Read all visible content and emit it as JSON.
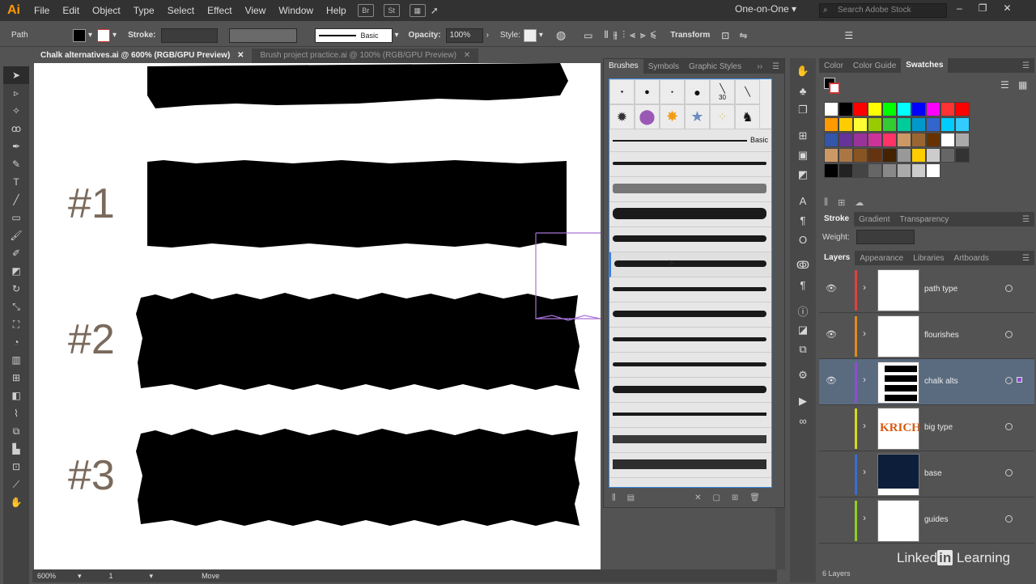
{
  "app": {
    "logo": "Ai"
  },
  "menu": [
    "File",
    "Edit",
    "Object",
    "Type",
    "Select",
    "Effect",
    "View",
    "Window",
    "Help"
  ],
  "menu_icons": [
    "Br",
    "St"
  ],
  "workspace": "One-on-One",
  "search_placeholder": "Search Adobe Stock",
  "control": {
    "object_type": "Path",
    "stroke_label": "Stroke:",
    "brush_name": "Basic",
    "opacity_label": "Opacity:",
    "opacity_value": "100%",
    "style_label": "Style:",
    "transform_label": "Transform"
  },
  "doc_tabs": [
    {
      "label": "Chalk alternatives.ai @ 600% (RGB/GPU Preview)",
      "active": true
    },
    {
      "label": "Brush project practice.ai @ 100% (RGB/GPU Preview)",
      "active": false
    }
  ],
  "canvas": {
    "labels": [
      "#1",
      "#2",
      "#3"
    ]
  },
  "status": {
    "zoom": "600%",
    "artboard": "1",
    "tool": "Move"
  },
  "brushes_panel": {
    "tabs": [
      "Brushes",
      "Symbols",
      "Graphic Styles"
    ],
    "size_label": "30",
    "basic_label": "Basic"
  },
  "color_panel": {
    "tabs": [
      "Color",
      "Color Guide",
      "Swatches"
    ],
    "swatch_rows": [
      [
        "#ffffff",
        "#000000",
        "#ff0000",
        "#ffff00",
        "#00ff00",
        "#00ffff",
        "#0000ff",
        "#ff00ff",
        "#ff3333",
        "#ff0000"
      ],
      [
        "#ff9900",
        "#ffcc00",
        "#ffff33",
        "#99cc00",
        "#33cc33",
        "#00cc99",
        "#0099cc",
        "#3366cc",
        "#00ccff",
        "#33ccff"
      ],
      [
        "#3355aa",
        "#663399",
        "#993399",
        "#cc3399",
        "#ff3366",
        "#cc9966",
        "#996633",
        "#663300",
        "#ffffff",
        "#aaaaaa"
      ],
      [
        "#cc9966",
        "#aa7744",
        "#885522",
        "#663311",
        "#442200",
        "#999999",
        "#ffcc00",
        "#cccccc",
        "#666666",
        "#333333"
      ],
      [
        "#000000",
        "#222222",
        "#444444",
        "#666666",
        "#888888",
        "#aaaaaa",
        "#cccccc",
        "#ffffff"
      ]
    ]
  },
  "stroke_panel": {
    "tabs": [
      "Stroke",
      "Gradient",
      "Transparency"
    ],
    "weight_label": "Weight:"
  },
  "layers_panel": {
    "tabs": [
      "Layers",
      "Appearance",
      "Libraries",
      "Artboards"
    ],
    "layers": [
      {
        "name": "path type",
        "color": "#e04040",
        "visible": true
      },
      {
        "name": "flourishes",
        "color": "#e08a20",
        "visible": true
      },
      {
        "name": "chalk alts",
        "color": "#8c4fd0",
        "visible": true,
        "selected": true
      },
      {
        "name": "big type",
        "color": "#d8d820",
        "visible": false,
        "thumb_text": "KRICH"
      },
      {
        "name": "base",
        "color": "#3a6cd0",
        "visible": false
      },
      {
        "name": "guides",
        "color": "#8fcf20",
        "visible": false
      }
    ],
    "count_label": "6 Layers"
  },
  "watermark": {
    "brand": "Linked",
    "in": "in",
    "product": "Learning"
  }
}
